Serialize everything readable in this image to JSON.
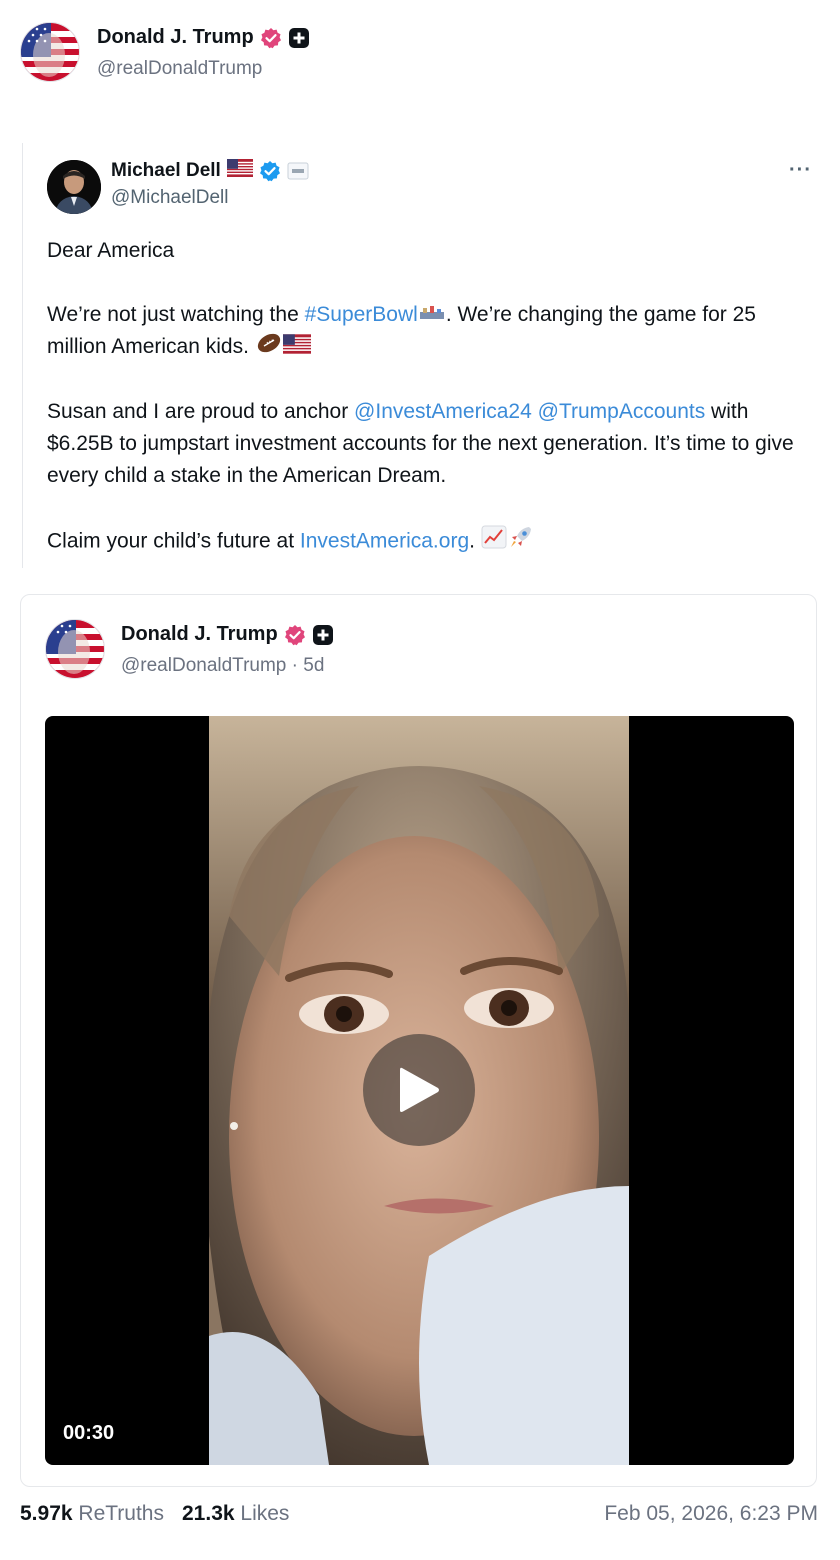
{
  "post": {
    "author_name": "Donald J. Trump",
    "author_handle": "@realDonaldTrump"
  },
  "quoted": {
    "author_name": "Michael Dell",
    "author_handle": "@MichaelDell",
    "more_label": "···",
    "lines": {
      "p1": "Dear America",
      "p2a": "We’re not just watching the ",
      "p2_hashtag": "#SuperBowl",
      "p2b": ". We’re changing the game for 25 million American kids. ",
      "p3a": "Susan and I are proud to anchor ",
      "p3_mention1": "@InvestAmerica24",
      "p3_space": " ",
      "p3_mention2": "@TrumpAccounts",
      "p3b": " with $6.25B to jumpstart investment accounts for the next generation. It’s time to give every child a stake in the American Dream.",
      "p4a": "Claim your child’s future at ",
      "p4_link": "InvestAmerica.org",
      "p4b": ". "
    }
  },
  "card": {
    "author_name": "Donald J. Trump",
    "author_handle": "@realDonaldTrump · 5d",
    "video_duration": "00:30"
  },
  "footer": {
    "retruths_count": "5.97k",
    "retruths_label": "ReTruths",
    "likes_count": "21.3k",
    "likes_label": "Likes",
    "timestamp": "Feb 05, 2026, 6:23 PM"
  },
  "colors": {
    "link": "#3b8bd8",
    "verified_pink": "#e0457b",
    "verified_blue": "#1d9bf0",
    "muted": "#6b7280"
  },
  "icons": [
    "verified-badge-icon",
    "plus-badge-icon",
    "more-icon",
    "play-icon",
    "flag-us-icon",
    "football-icon",
    "chart-up-icon",
    "rocket-icon"
  ]
}
